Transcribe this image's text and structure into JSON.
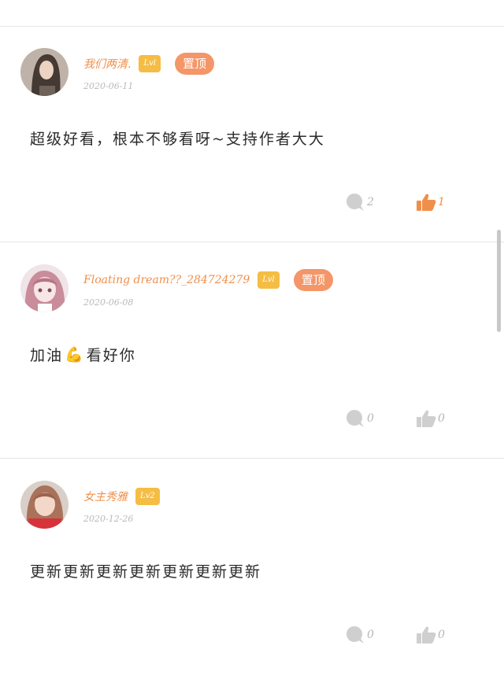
{
  "comments": [
    {
      "username": "我们两清.",
      "level": "Lvl",
      "pinned_label": "置顶",
      "date": "2020-06-11",
      "content": "超级好看，根本不够看呀~支持作者大大",
      "reply_count": "2",
      "like_count": "1",
      "liked": true,
      "avatar_icon": "avatar-photo"
    },
    {
      "username": "Floating dream??_284724279",
      "level": "Lvl",
      "pinned_label": "置顶",
      "date": "2020-06-08",
      "content_before": "加油",
      "content_emoji": "💪",
      "content_after": "看好你",
      "reply_count": "0",
      "like_count": "0",
      "liked": false,
      "avatar_icon": "anime-avatar"
    },
    {
      "username": "女主秀雅",
      "level": "Lv2",
      "date": "2020-12-26",
      "content": "更新更新更新更新更新更新更新",
      "reply_count": "0",
      "like_count": "0",
      "liked": false,
      "avatar_icon": "avatar-photo"
    }
  ],
  "colors": {
    "accent": "#f08f4a",
    "level_badge": "#f5bd44",
    "pin_badge": "#f49668",
    "muted": "#b5b5b5"
  }
}
